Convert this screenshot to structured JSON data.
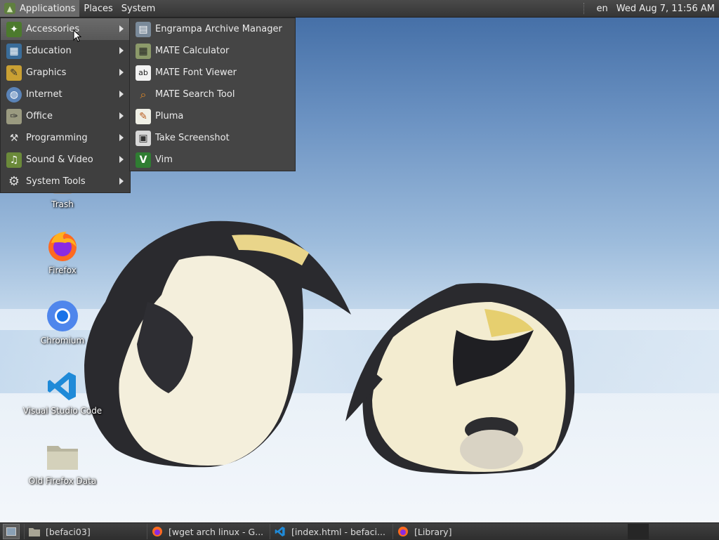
{
  "top_panel": {
    "applications": "Applications",
    "places": "Places",
    "system": "System",
    "language": "en",
    "clock": "Wed Aug  7, 11:56 AM"
  },
  "main_menu": {
    "items": [
      {
        "label": "Accessories",
        "icon": "accessories-icon"
      },
      {
        "label": "Education",
        "icon": "education-icon"
      },
      {
        "label": "Graphics",
        "icon": "graphics-icon"
      },
      {
        "label": "Internet",
        "icon": "internet-icon"
      },
      {
        "label": "Office",
        "icon": "office-icon"
      },
      {
        "label": "Programming",
        "icon": "programming-icon"
      },
      {
        "label": "Sound & Video",
        "icon": "sound-video-icon"
      },
      {
        "label": "System Tools",
        "icon": "system-tools-icon"
      }
    ]
  },
  "accessories_menu": {
    "items": [
      {
        "label": "Engrampa Archive Manager",
        "icon": "archive-manager-icon"
      },
      {
        "label": "MATE Calculator",
        "icon": "calculator-icon"
      },
      {
        "label": "MATE Font Viewer",
        "icon": "font-viewer-icon"
      },
      {
        "label": "MATE Search Tool",
        "icon": "search-tool-icon"
      },
      {
        "label": "Pluma",
        "icon": "text-editor-icon"
      },
      {
        "label": "Take Screenshot",
        "icon": "screenshot-icon"
      },
      {
        "label": "Vim",
        "icon": "vim-icon"
      }
    ]
  },
  "desktop": {
    "icons": [
      {
        "label": "Trash",
        "icon": "trash-icon"
      },
      {
        "label": "Firefox",
        "icon": "firefox-icon"
      },
      {
        "label": "Chromium",
        "icon": "chromium-icon"
      },
      {
        "label": "Visual Studio Code",
        "icon": "vscode-icon"
      },
      {
        "label": "Old Firefox Data",
        "icon": "folder-icon"
      }
    ]
  },
  "taskbar": {
    "tasks": [
      {
        "label": "[befaci03]",
        "icon": "folder-icon"
      },
      {
        "label": "[wget arch linux - G...",
        "icon": "firefox-icon"
      },
      {
        "label": "[index.html - befaci...",
        "icon": "vscode-icon"
      },
      {
        "label": "[Library]",
        "icon": "firefox-icon"
      }
    ]
  },
  "colors": {
    "panel_bg": "#353535",
    "menu_bg": "#3f3f3f",
    "menu_highlight": "#6b6b6b",
    "text": "#ececec"
  }
}
